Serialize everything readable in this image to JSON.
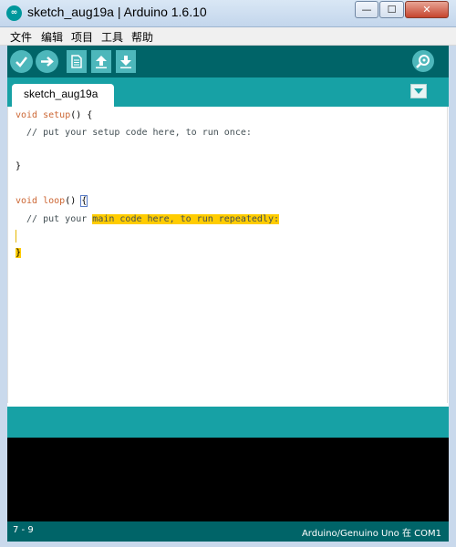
{
  "window": {
    "title": "sketch_aug19a | Arduino 1.6.10",
    "logo_text": "∞",
    "min_glyph": "—",
    "max_glyph": "☐",
    "close_glyph": "✕"
  },
  "menu": {
    "items": [
      {
        "label": "文件"
      },
      {
        "label": "编辑"
      },
      {
        "label": "项目"
      },
      {
        "label": "工具"
      },
      {
        "label": "帮助"
      }
    ]
  },
  "toolbar": {
    "buttons": [
      {
        "name": "verify",
        "icon": "checkmark-icon"
      },
      {
        "name": "upload",
        "icon": "arrow-right-icon"
      },
      {
        "name": "new",
        "icon": "document-icon"
      },
      {
        "name": "open",
        "icon": "arrow-up-icon"
      },
      {
        "name": "save",
        "icon": "arrow-down-icon"
      },
      {
        "name": "serial-monitor",
        "icon": "magnifier-icon"
      }
    ],
    "accent_color": "#4db7bb",
    "background_color": "#006468"
  },
  "tabs": {
    "active": "sketch_aug19a",
    "menu_icon": "triangle-down-icon"
  },
  "editor": {
    "lines": {
      "l1_kw": "void",
      "l1_fn": "setup",
      "l1_rest": "() {",
      "l2": "  // put your setup code here, to run once:",
      "l3": "",
      "l4": "}",
      "l5": "",
      "l6_kw": "void",
      "l6_fn": "loop",
      "l6_rest": "() ",
      "l6_brace": "{",
      "l7_pre": "  // put your ",
      "l7_hl": "main code here, to run repeatedly:",
      "l9_brace": "}"
    },
    "highlight_color": "#ffcc00"
  },
  "footer": {
    "cursor_position": "7 - 9",
    "board": "Arduino/Genuino Uno 在 COM1"
  }
}
